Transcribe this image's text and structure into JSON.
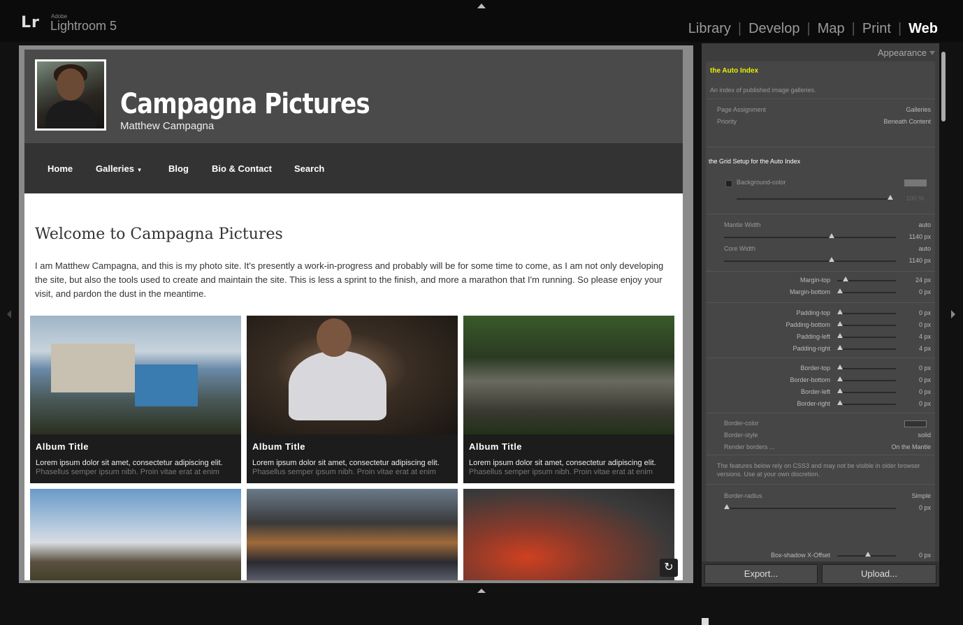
{
  "app": {
    "logo": "Lr",
    "vendor": "Adobe",
    "name": "Lightroom 5"
  },
  "modules": [
    {
      "label": "Library",
      "active": false
    },
    {
      "label": "Develop",
      "active": false
    },
    {
      "label": "Map",
      "active": false
    },
    {
      "label": "Print",
      "active": false
    },
    {
      "label": "Web",
      "active": true
    }
  ],
  "site": {
    "title": "Campagna Pictures",
    "subtitle": "Matthew Campagna",
    "nav": [
      "Home",
      "Galleries",
      "Blog",
      "Bio & Contact",
      "Search"
    ],
    "welcome": "Welcome to Campagna Pictures",
    "intro": "I am Matthew Campagna, and this is my photo site. It's presently a work-in-progress and probably will be for some time to come, as I am not only developing the site, but also the tools used to create and maintain the site. This is less a sprint to the finish, and more a marathon that I'm running. So please enjoy your visit, and pardon the dust in the meantime.",
    "cards": [
      {
        "title": "Album Title",
        "text": "Lorem ipsum dolor sit amet, consectetur adipiscing elit.",
        "text2": "Phasellus semper ipsum nibh. Proin vitae erat at enim"
      },
      {
        "title": "Album Title",
        "text": "Lorem ipsum dolor sit amet, consectetur adipiscing elit.",
        "text2": "Phasellus semper ipsum nibh. Proin vitae erat at enim"
      },
      {
        "title": "Album Title",
        "text": "Lorem ipsum dolor sit amet, consectetur adipiscing elit.",
        "text2": "Phasellus semper ipsum nibh. Proin vitae erat at enim"
      }
    ]
  },
  "panel": {
    "header": "Appearance",
    "title": "the Auto Index",
    "desc": "An index of published image galleries.",
    "page_assignment_label": "Page Assignment",
    "page_assignment_value": "Galleries",
    "priority_label": "Priority",
    "priority_value": "Beneath Content",
    "grid_setup": "the Grid Setup for the Auto Index",
    "bg_color_label": "Background-color",
    "bg_opacity": "100 %",
    "mantle_width_label": "Mantle Width",
    "mantle_width_mode": "auto",
    "mantle_width_value": "1140 px",
    "core_width_label": "Core Width",
    "core_width_mode": "auto",
    "core_width_value": "1140 px",
    "margin_top_label": "Margin-top",
    "margin_top_value": "24 px",
    "margin_bottom_label": "Margin-bottom",
    "margin_bottom_value": "0 px",
    "padding_top_label": "Padding-top",
    "padding_top_value": "0 px",
    "padding_bottom_label": "Padding-bottom",
    "padding_bottom_value": "0 px",
    "padding_left_label": "Padding-left",
    "padding_left_value": "4 px",
    "padding_right_label": "Padding-right",
    "padding_right_value": "4 px",
    "border_top_label": "Border-top",
    "border_top_value": "0 px",
    "border_bottom_label": "Border-bottom",
    "border_bottom_value": "0 px",
    "border_left_label": "Border-left",
    "border_left_value": "0 px",
    "border_right_label": "Border-right",
    "border_right_value": "0 px",
    "border_color_label": "Border-color",
    "border_style_label": "Border-style",
    "border_style_value": "solid",
    "render_borders_label": "Render borders ...",
    "render_borders_value": "On the Mantle",
    "css3_note": "The features below rely on CSS3 and may not be visible in older browser versions. Use at your own discretion.",
    "border_radius_label": "Border-radius",
    "border_radius_mode": "Simple",
    "border_radius_value": "0 px",
    "box_shadow_label": "Box-shadow X-Offset",
    "box_shadow_value": "0 px"
  },
  "buttons": {
    "export": "Export...",
    "upload": "Upload..."
  }
}
